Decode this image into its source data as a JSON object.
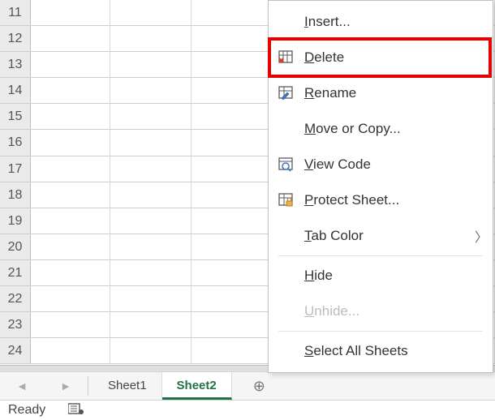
{
  "grid": {
    "row_start": 11,
    "row_end": 24
  },
  "tabs": {
    "sheet1": "Sheet1",
    "sheet2": "Sheet2"
  },
  "status": {
    "ready": "Ready"
  },
  "menu": {
    "insert": "Insert...",
    "delete": "Delete",
    "rename": "Rename",
    "move": "Move or Copy...",
    "viewcode": "View Code",
    "protect": "Protect Sheet...",
    "tabcolor": "Tab Color",
    "hide": "Hide",
    "unhide": "Unhide...",
    "selall": "Select All Sheets"
  },
  "underline_index": {
    "insert": 0,
    "delete": 0,
    "rename": 0,
    "move": 0,
    "viewcode": 0,
    "protect": 0,
    "tabcolor": 0,
    "hide": 0,
    "unhide": 0,
    "selall": 0
  }
}
